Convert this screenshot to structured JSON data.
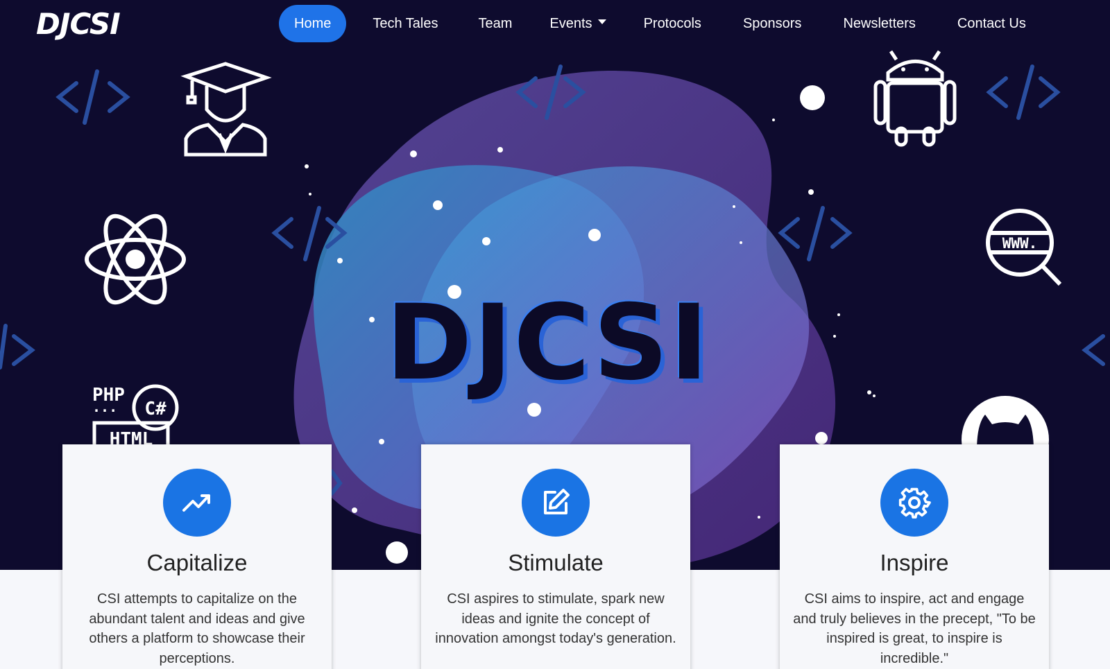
{
  "nav": {
    "brand": "DJCSI",
    "links": [
      {
        "label": "Home",
        "active": true
      },
      {
        "label": "Tech Tales"
      },
      {
        "label": "Team"
      },
      {
        "label": "Events",
        "dropdown": true
      },
      {
        "label": "Protocols"
      },
      {
        "label": "Sponsors"
      },
      {
        "label": "Newsletters"
      },
      {
        "label": "Contact Us"
      }
    ]
  },
  "hero": {
    "title": "DJCSI",
    "icon_labels": {
      "php": "PHP",
      "csharp": "C#",
      "html": "HTML",
      "www": "WWW."
    }
  },
  "cards": [
    {
      "title": "Capitalize",
      "icon": "trending-up-icon",
      "text": "CSI attempts to capitalize on the abundant talent and ideas and give others a platform to showcase their perceptions."
    },
    {
      "title": "Stimulate",
      "icon": "edit-icon",
      "text": "CSI aspires to stimulate, spark new ideas and ignite the concept of innovation amongst today's generation."
    },
    {
      "title": "Inspire",
      "icon": "gear-icon",
      "text": "CSI aims to inspire, act and engage and truly believes in the precept, \"To be inspired is great, to inspire is incredible.\""
    }
  ],
  "colors": {
    "accent": "#1f73e8",
    "hero_bg": "#0e0b2e",
    "card_bg": "#f6f7fa"
  }
}
